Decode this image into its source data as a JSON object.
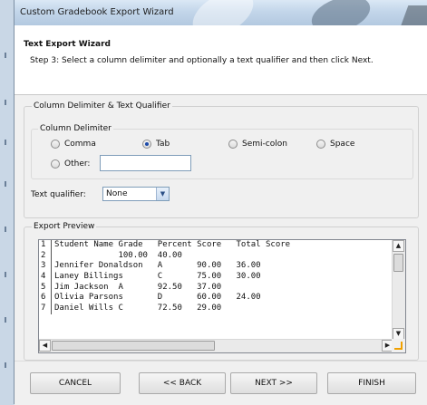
{
  "window": {
    "title": "Custom Gradebook Export Wizard"
  },
  "header": {
    "title": "Text Export Wizard",
    "subtitle": "Step 3: Select a column delimiter and optionally a text qualifier and then click Next."
  },
  "delimiter_group": {
    "legend": "Column Delimiter & Text Qualifier",
    "inner_legend": "Column Delimiter",
    "options": [
      {
        "label": "Comma",
        "selected": false
      },
      {
        "label": "Tab",
        "selected": true
      },
      {
        "label": "Semi-colon",
        "selected": false
      },
      {
        "label": "Space",
        "selected": false
      },
      {
        "label": "Other:",
        "selected": false
      }
    ],
    "other_value": "",
    "text_qualifier_label": "Text qualifier:",
    "text_qualifier_value": "None"
  },
  "preview": {
    "legend": "Export Preview",
    "rows": [
      {
        "n": "1",
        "text": "Student Name Grade   Percent Score   Total Score"
      },
      {
        "n": "2",
        "text": "             100.00  40.00"
      },
      {
        "n": "3",
        "text": "Jennifer Donaldson   A       90.00   36.00"
      },
      {
        "n": "4",
        "text": "Laney Billings       C       75.00   30.00"
      },
      {
        "n": "5",
        "text": "Jim Jackson  A       92.50   37.00"
      },
      {
        "n": "6",
        "text": "Olivia Parsons       D       60.00   24.00"
      },
      {
        "n": "7",
        "text": "Daniel Wills C       72.50   29.00"
      }
    ]
  },
  "buttons": {
    "cancel": "CANCEL",
    "back": "<< BACK",
    "next": "NEXT >>",
    "finish": "FINISH"
  },
  "icons": {
    "radio_selected_color": "#1c4aa8",
    "corner_grip_color": "#f0a000"
  }
}
